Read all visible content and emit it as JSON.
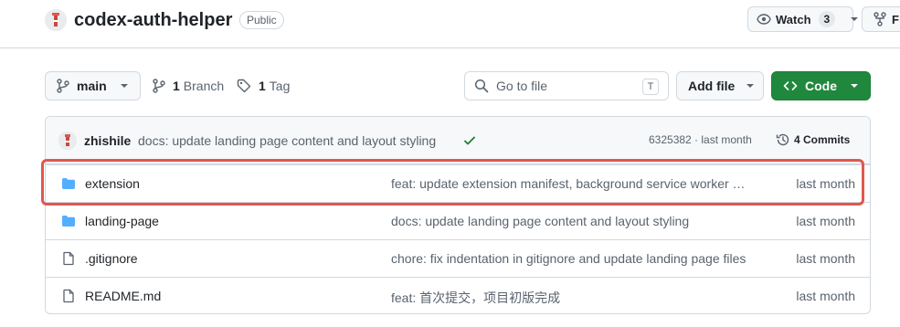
{
  "repo": {
    "name": "codex-auth-helper",
    "visibility": "Public",
    "watch_label": "Watch",
    "watch_count": "3",
    "fork_label": "F"
  },
  "toolbar": {
    "branch": "main",
    "branch_count": "1",
    "branch_label": "Branch",
    "tag_count": "1",
    "tag_label": "Tag",
    "goto_placeholder": "Go to file",
    "goto_shortcut": "T",
    "add_file_label": "Add file",
    "code_label": "Code"
  },
  "latest_commit": {
    "author": "zhishile",
    "message": "docs: update landing page content and layout styling",
    "hash_and_time": "6325382 · last month",
    "commits_label": "4 Commits"
  },
  "files": [
    {
      "name": "extension",
      "type": "folder",
      "message": "feat: update extension manifest, background service worker and popup",
      "date": "last month"
    },
    {
      "name": "landing-page",
      "type": "folder",
      "message": "docs: update landing page content and layout styling",
      "date": "last month"
    },
    {
      "name": ".gitignore",
      "type": "file",
      "message": "chore: fix indentation in gitignore and update landing page files",
      "date": "last month"
    },
    {
      "name": "README.md",
      "type": "file",
      "message": "feat: 首次提交，项目初版完成",
      "date": "last month"
    }
  ],
  "colors": {
    "accent_green": "#1f883d",
    "folder_blue": "#54aeff",
    "highlight_red": "#e0574f"
  }
}
